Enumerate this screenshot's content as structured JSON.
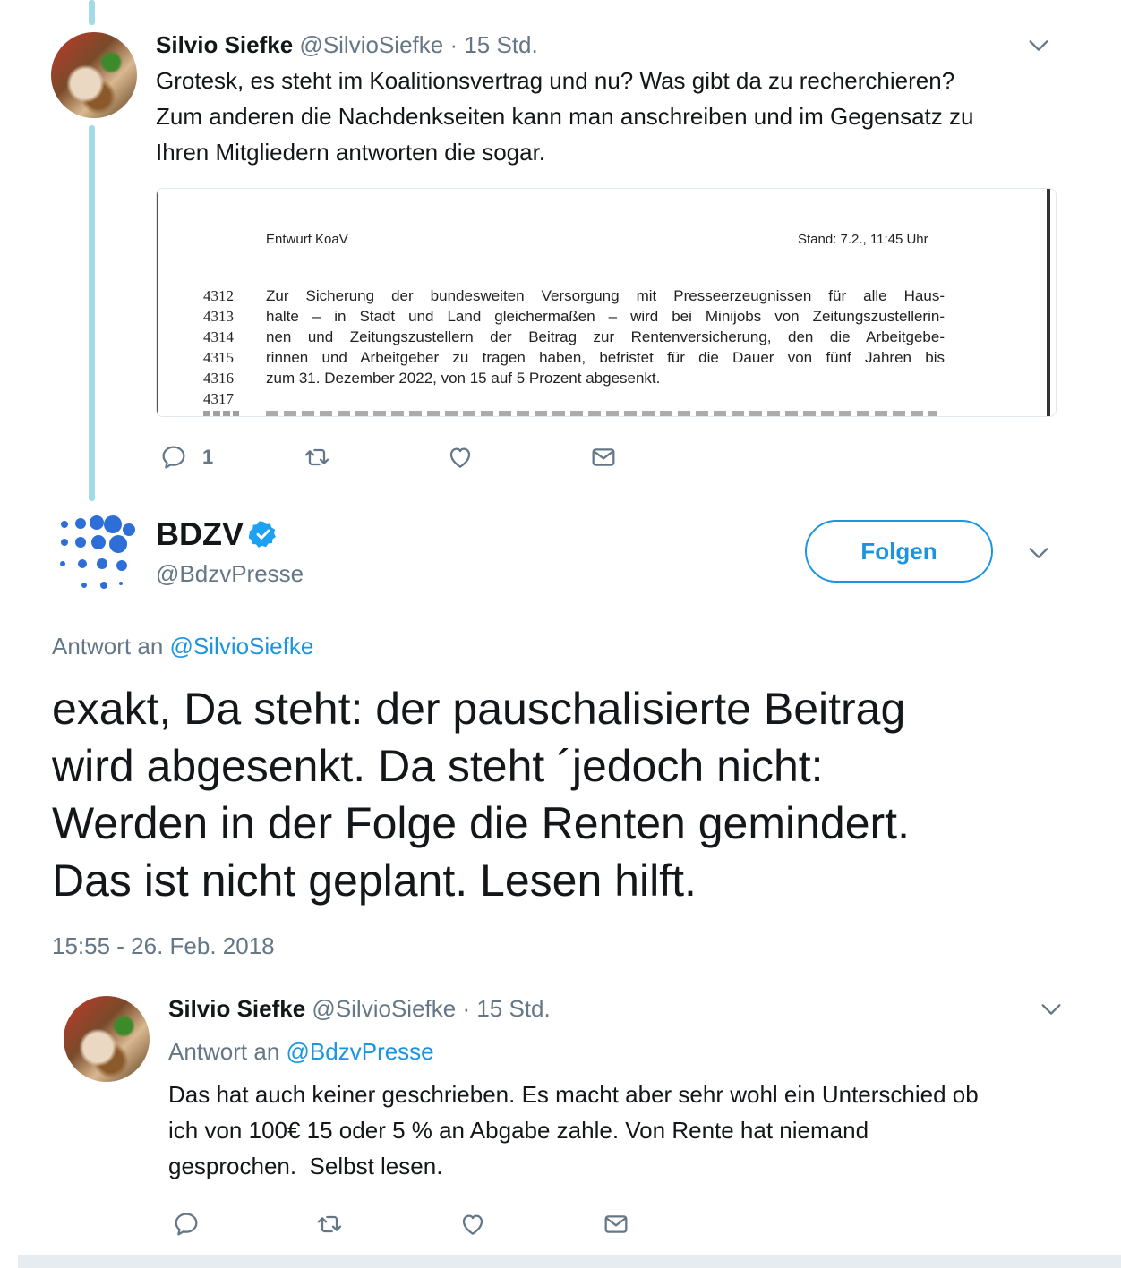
{
  "tweet1": {
    "author_name": "Silvio Siefke",
    "author_handle": "@SilvioSiefke",
    "time": "· 15 Std.",
    "text_lines": [
      "Grotesk, es steht im Koalitionsvertrag und nu? Was gibt da zu recherchieren?",
      "Zum anderen die Nachdenkseiten kann man anschreiben und im Gegensatz zu",
      "Ihren Mitgliedern antworten die sogar."
    ],
    "media": {
      "header_left": "Entwurf KoaV",
      "header_right": "Stand: 7.2., 11:45 Uhr",
      "lines": [
        {
          "no": "4312",
          "text": "Zur Sicherung der bundesweiten Versorgung mit Presseerzeugnissen für alle Haus-"
        },
        {
          "no": "4313",
          "text": "halte – in Stadt und Land gleichermaßen – wird bei Minijobs von Zeitungszustellerin-"
        },
        {
          "no": "4314",
          "text": "nen und Zeitungszustellern der Beitrag zur Rentenversicherung, den die Arbeitgebe-"
        },
        {
          "no": "4315",
          "text": "rinnen und Arbeitgeber zu tragen haben, befristet für die Dauer von fünf Jahren bis"
        },
        {
          "no": "4316",
          "text": "zum 31. Dezember 2022, von 15 auf 5 Prozent abgesenkt."
        },
        {
          "no": "4317",
          "text": ""
        }
      ]
    },
    "reply_count": "1"
  },
  "main_tweet": {
    "author_name": "BDZV",
    "author_handle": "@BdzvPresse",
    "follow_label": "Folgen",
    "reply_prefix": "Antwort an",
    "reply_target": "@SilvioSiefke",
    "text_lines": [
      "exakt, Da steht: der pauschalisierte Beitrag",
      "wird abgesenkt. Da steht ´jedoch nicht:",
      "Werden in der Folge die Renten gemindert.",
      "Das ist nicht geplant. Lesen hilft."
    ],
    "timestamp": "15:55 - 26. Feb. 2018"
  },
  "tweet3": {
    "author_name": "Silvio Siefke",
    "author_handle": "@SilvioSiefke",
    "time": "· 15 Std.",
    "reply_prefix": "Antwort an",
    "reply_target": "@BdzvPresse",
    "text_lines": [
      "Das hat auch keiner geschrieben. Es macht aber sehr wohl ein Unterschied ob",
      "ich von 100€ 15 oder 5 % an Abgabe zahle. Von Rente hat niemand",
      "gesprochen.  Selbst lesen."
    ]
  },
  "colors": {
    "accent": "#1b95e0",
    "thread_line": "#a2dbe8",
    "muted": "#657786",
    "text": "#14171a"
  },
  "icons": [
    "reply-icon",
    "retweet-icon",
    "like-icon",
    "message-icon",
    "chevron-down-icon",
    "verified-icon"
  ]
}
